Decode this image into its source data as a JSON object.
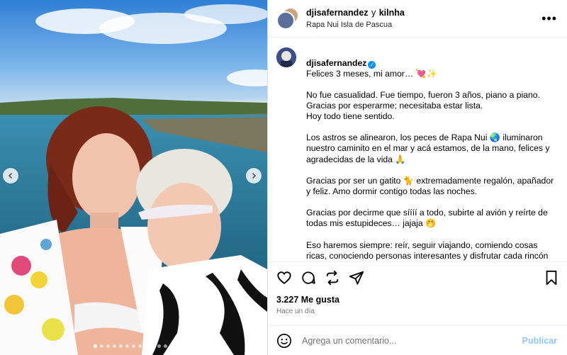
{
  "header": {
    "user": "djisafernandez",
    "connector": "y",
    "collaborator": "kilnha",
    "location": "Rapa Nui Isla de Pascua",
    "more": "•••"
  },
  "caption": {
    "user": "djisafernandez",
    "first_line": "Felices 3 meses, mi amor… 💘✨",
    "paragraphs": [
      "No fue casualidad. Fue tiempo, fueron 3 años, piano a piano.\nGracias por esperarme; necesitaba estar lista.\nHoy todo tiene sentido.",
      "Los astros se alinearon, los peces de Rapa Nui 🌏 iluminaron nuestro caminito en el mar y acá estamos, de la mano, felices y agradecidas de la vida 🙏",
      "Gracias por ser un gatito 🐈 extremadamente regalón, apañador y feliz. Amo dormir contigo todas las noches.",
      "Gracias por decirme que síííí a todo, subirte al avión y reírte de todas mis estupideces… jajaja 🤭",
      "Eso haremos siempre: reír, seguir viajando, comiendo cosas ricas, conociendo personas interesantes y disfrutar cada rincón del mundo."
    ]
  },
  "stats": {
    "likes": "3.227 Me gusta",
    "time": "Hace un día"
  },
  "comment_box": {
    "placeholder": "Agrega un comentario...",
    "publish": "Publicar"
  },
  "carousel": {
    "slide_count": 13,
    "active_index": 0
  },
  "icons": [
    "heart-icon",
    "comment-icon",
    "share-icon",
    "send-icon",
    "bookmark-icon",
    "emoji-icon",
    "chevron-left-icon",
    "chevron-right-icon",
    "verified-icon"
  ],
  "colors": {
    "accent": "#0095f6",
    "publish": "#8fc6f7",
    "muted": "#737373"
  }
}
